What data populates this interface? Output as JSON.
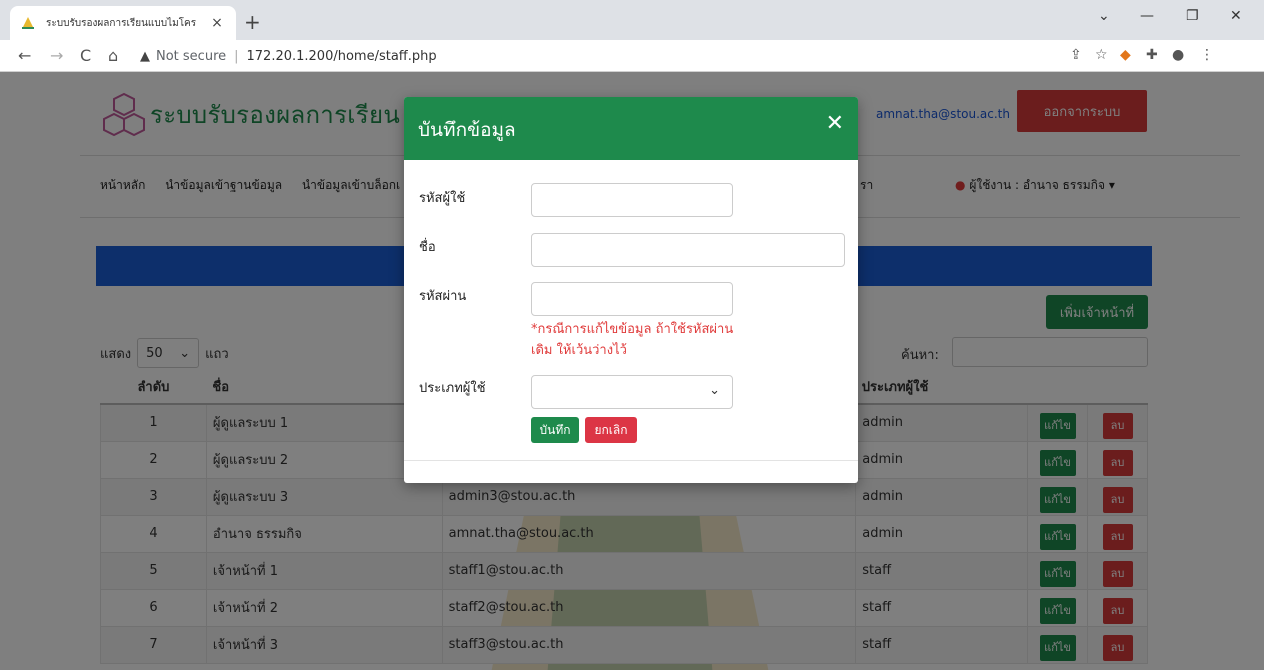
{
  "browser": {
    "tab_title": "ระบบรับรองผลการเรียนแบบไมโคร",
    "tab_close": "×",
    "new_tab": "+",
    "security_label": "Not secure",
    "url": "172.20.1.200/home/staff.php",
    "controls": {
      "minimize": "—",
      "restore": "❐",
      "close": "✕",
      "caret": "⌄"
    },
    "nav": {
      "back": "←",
      "forward": "→",
      "reload": "C",
      "home": "⌂"
    }
  },
  "header": {
    "site_title": "ระบบรับรองผลการเรียน",
    "user_email": "amnat.tha@stou.ac.th",
    "logout_label": "ออกจากระบบ"
  },
  "nav": {
    "items": [
      "หน้าหลัก",
      "นำข้อมูลเข้าฐานข้อมูล",
      "นำข้อมูลเข้าบล็อกเ"
    ],
    "partial_item": "รา",
    "user_label": "ผู้ใช้งาน : อำนาจ ธรรมกิจ",
    "user_caret": "▾"
  },
  "list": {
    "add_staff_label": "เพิ่มเจ้าหน้าที่",
    "show_prefix": "แสดง",
    "show_value": "50",
    "show_caret": "⌄",
    "show_suffix": "แถว",
    "search_label": "ค้นหา:",
    "columns": [
      "ลำดับ",
      "ชื่อ",
      "",
      "ประเภทผู้ใช้",
      "",
      ""
    ],
    "edit_label": "แก้ไข",
    "delete_label": "ลบ",
    "rows": [
      {
        "no": "1",
        "name": "ผู้ดูแลระบบ 1",
        "email": "",
        "type": "admin"
      },
      {
        "no": "2",
        "name": "ผู้ดูแลระบบ 2",
        "email": "",
        "type": "admin"
      },
      {
        "no": "3",
        "name": "ผู้ดูแลระบบ 3",
        "email": "admin3@stou.ac.th",
        "type": "admin"
      },
      {
        "no": "4",
        "name": "อำนาจ ธรรมกิจ",
        "email": "amnat.tha@stou.ac.th",
        "type": "admin"
      },
      {
        "no": "5",
        "name": "เจ้าหน้าที่ 1",
        "email": "staff1@stou.ac.th",
        "type": "staff"
      },
      {
        "no": "6",
        "name": "เจ้าหน้าที่ 2",
        "email": "staff2@stou.ac.th",
        "type": "staff"
      },
      {
        "no": "7",
        "name": "เจ้าหน้าที่ 3",
        "email": "staff3@stou.ac.th",
        "type": "staff"
      }
    ]
  },
  "modal": {
    "title": "บันทึกข้อมูล",
    "close": "✕",
    "user_id_label": "รหัสผู้ใช้",
    "name_label": "ชื่อ",
    "password_label": "รหัสผ่าน",
    "password_hint": "*กรณีการแก้ไขข้อมูล ถ้าใช้รหัสผ่านเดิม ให้เว้นว่างไว้",
    "user_type_label": "ประเภทผู้ใช้",
    "user_type_caret": "⌄",
    "save_label": "บันทึก",
    "cancel_label": "ยกเลิก"
  },
  "colors": {
    "brand_green": "#1e8a4c",
    "danger_red": "#d73b3b",
    "banner_blue": "#1a5fd6",
    "link_blue": "#1a56d6"
  }
}
